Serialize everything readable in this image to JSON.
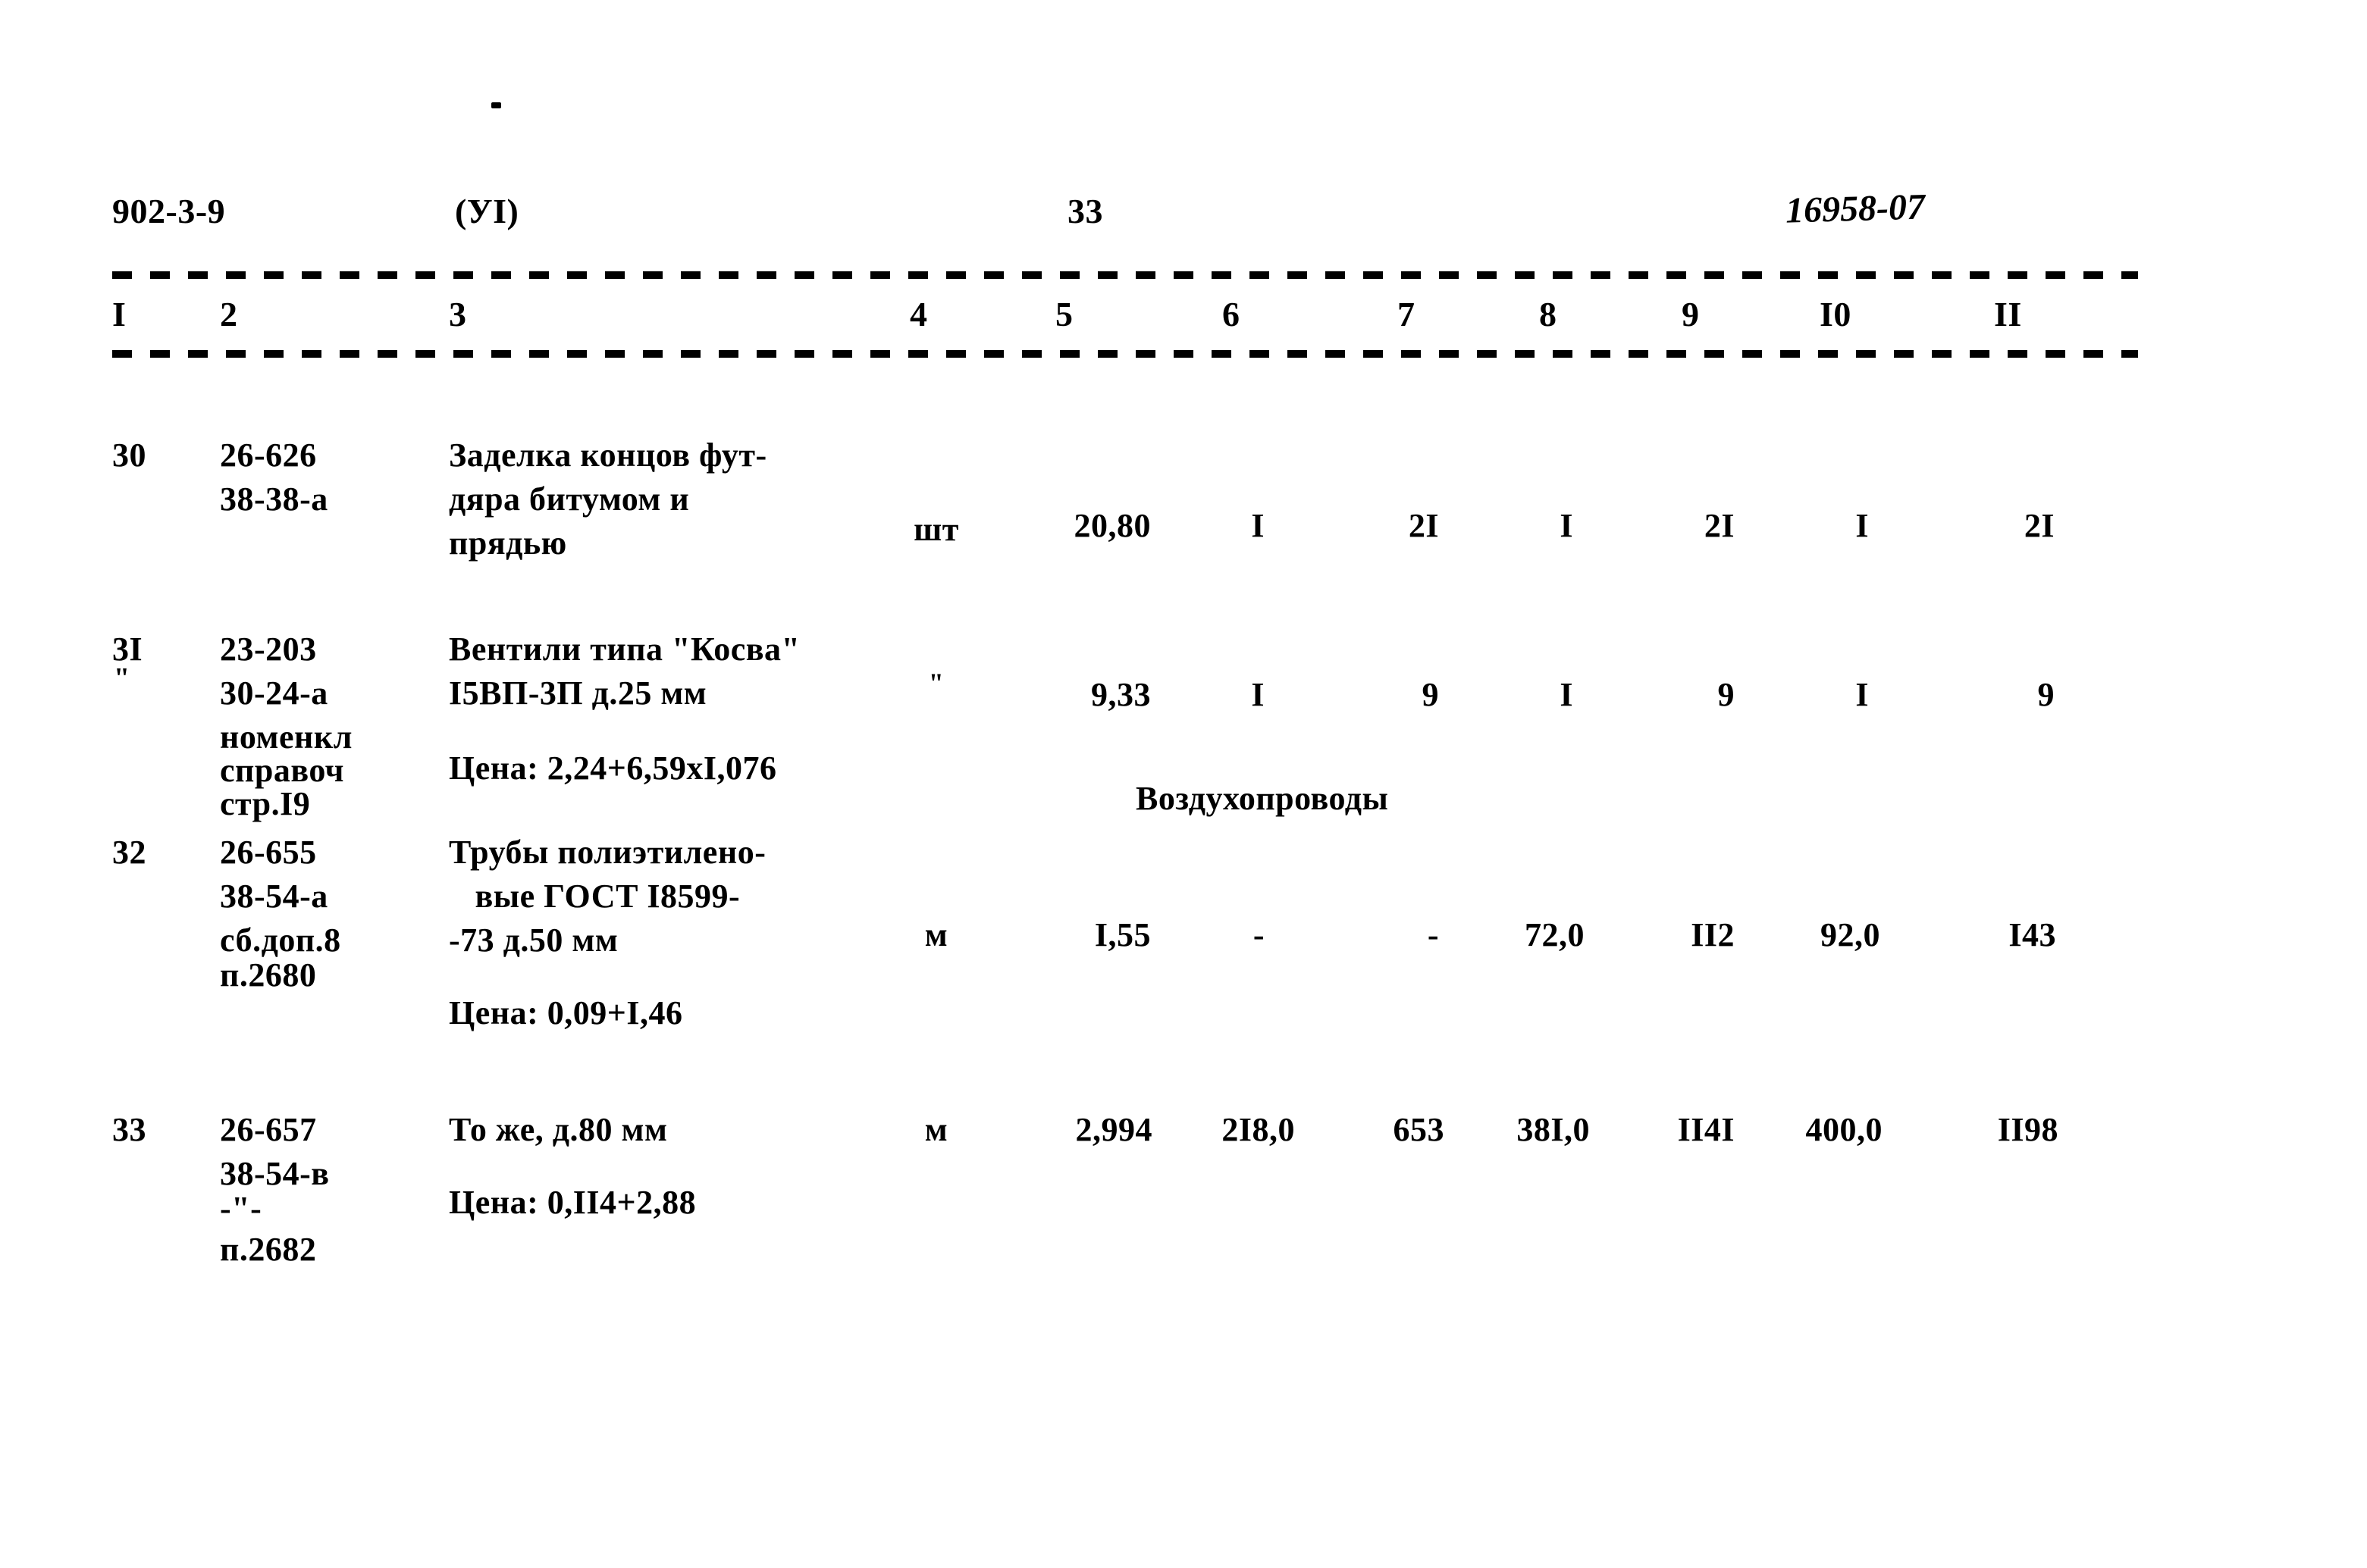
{
  "header": {
    "doc_code": "902-3-9",
    "section": "(УI)",
    "page_number": "33",
    "stamp": "16958-07"
  },
  "table": {
    "column_headers": [
      "I",
      "2",
      "3",
      "4",
      "5",
      "6",
      "7",
      "8",
      "9",
      "I0",
      "II"
    ],
    "section_title": "Воздухопроводы",
    "rows": [
      {
        "pos": "30",
        "pos_mark": "",
        "codes": [
          "26-626",
          "38-38-а"
        ],
        "desc": [
          "Заделка концов фут-",
          "дяра битумом и",
          "прядью"
        ],
        "price": "",
        "unit": "шт",
        "values": [
          "20,80",
          "I",
          "2I",
          "I",
          "2I",
          "I",
          "2I"
        ]
      },
      {
        "pos": "3I",
        "pos_mark": "\"",
        "codes": [
          "23-203",
          "30-24-а",
          "номенкл",
          "справоч",
          "стр.I9"
        ],
        "desc": [
          "Вентили типа \"Косва\"",
          "I5ВП-3П д.25 мм"
        ],
        "price": "Цена: 2,24+6,59хI,076",
        "unit": "\"",
        "values": [
          "9,33",
          "I",
          "9",
          "I",
          "9",
          "I",
          "9"
        ]
      },
      {
        "pos": "32",
        "pos_mark": "",
        "codes": [
          "26-655",
          "38-54-а",
          "сб.доп.8",
          "п.2680"
        ],
        "desc": [
          "Трубы полиэтилено-",
          "   вые ГОСТ I8599-",
          "-73 д.50 мм"
        ],
        "price": "Цена: 0,09+I,46",
        "unit": "м",
        "values": [
          "I,55",
          "-",
          "-",
          "72,0",
          "II2",
          "92,0",
          "I43"
        ]
      },
      {
        "pos": "33",
        "pos_mark": "",
        "codes": [
          "26-657",
          "38-54-в",
          "-\"-",
          "п.2682"
        ],
        "desc": [
          "То же, д.80 мм"
        ],
        "price": "Цена: 0,II4+2,88",
        "unit": "м",
        "values": [
          "2,994",
          "2I8,0",
          "653",
          "38I,0",
          "II4I",
          "400,0",
          "II98"
        ]
      }
    ]
  }
}
